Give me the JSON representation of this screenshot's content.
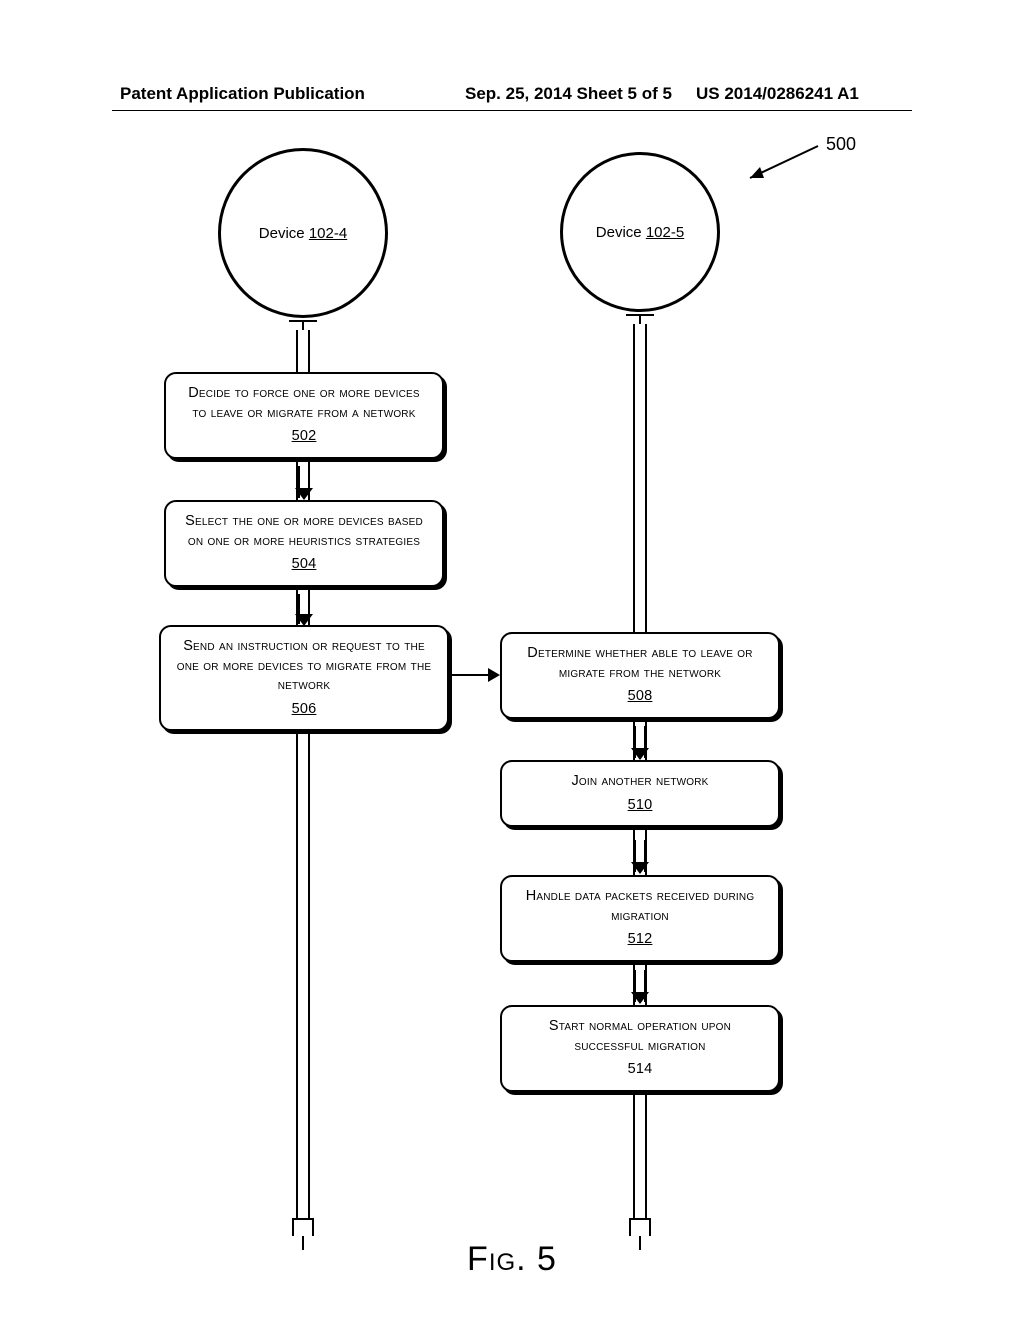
{
  "header": {
    "left": "Patent Application Publication",
    "center": "Sep. 25, 2014  Sheet 5 of 5",
    "right": "US 2014/0286241 A1"
  },
  "reference_label": "500",
  "actors": {
    "a": {
      "prefix": "Device ",
      "id": "102-4"
    },
    "b": {
      "prefix": "Device ",
      "id": "102-5"
    }
  },
  "steps": {
    "s502": {
      "text": "Decide to force one or more devices to leave or migrate from a network",
      "num": "502"
    },
    "s504": {
      "text": "Select the one or more devices based on one or more heuristics strategies",
      "num": "504"
    },
    "s506": {
      "text": "Send an instruction or request to the one or more devices to migrate from the network",
      "num": "506"
    },
    "s508": {
      "text": "Determine whether able to leave or migrate from the network",
      "num": "508"
    },
    "s510": {
      "text": "Join another network",
      "num": "510"
    },
    "s512": {
      "text": "Handle data packets received during migration",
      "num": "512"
    },
    "s514": {
      "text": "Start normal operation upon successful migration",
      "num": "514"
    }
  },
  "figure_label": "Fig. 5"
}
